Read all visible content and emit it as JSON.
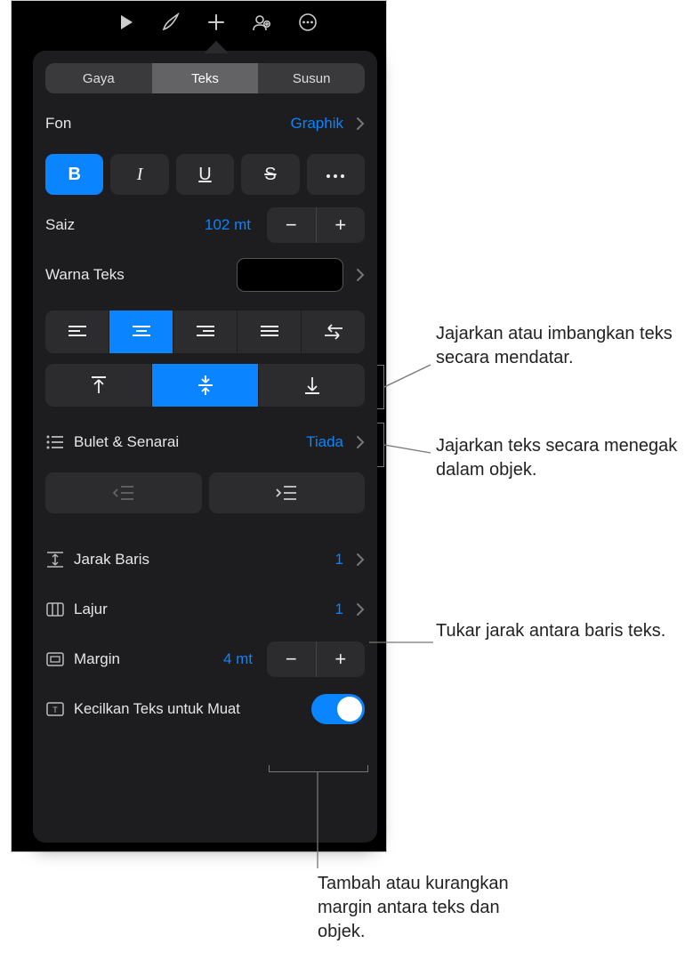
{
  "toolbar_icons": [
    "play-icon",
    "brush-icon",
    "plus-icon",
    "collab-icon",
    "more-icon"
  ],
  "tabs": {
    "items": [
      "Gaya",
      "Teks",
      "Susun"
    ],
    "active": 1
  },
  "font": {
    "label": "Fon",
    "value": "Graphik"
  },
  "styles": {
    "bold_active": true
  },
  "size": {
    "label": "Saiz",
    "value": "102 mt"
  },
  "textcolor": {
    "label": "Warna Teks",
    "value": "#000000"
  },
  "halign": {
    "active": 1
  },
  "valign": {
    "active": 1
  },
  "bullets": {
    "label": "Bulet & Senarai",
    "value": "Tiada"
  },
  "line_spacing": {
    "label": "Jarak Baris",
    "value": "1"
  },
  "columns": {
    "label": "Lajur",
    "value": "1"
  },
  "margin": {
    "label": "Margin",
    "value": "4 mt"
  },
  "shrink": {
    "label": "Kecilkan Teks untuk Muat",
    "on": true
  },
  "callouts": {
    "halign": "Jajarkan atau imbangkan teks secara mendatar.",
    "valign": "Jajarkan teks secara menegak dalam objek.",
    "line": "Tukar jarak antara baris teks.",
    "margin": "Tambah atau kurangkan margin antara teks dan objek."
  }
}
